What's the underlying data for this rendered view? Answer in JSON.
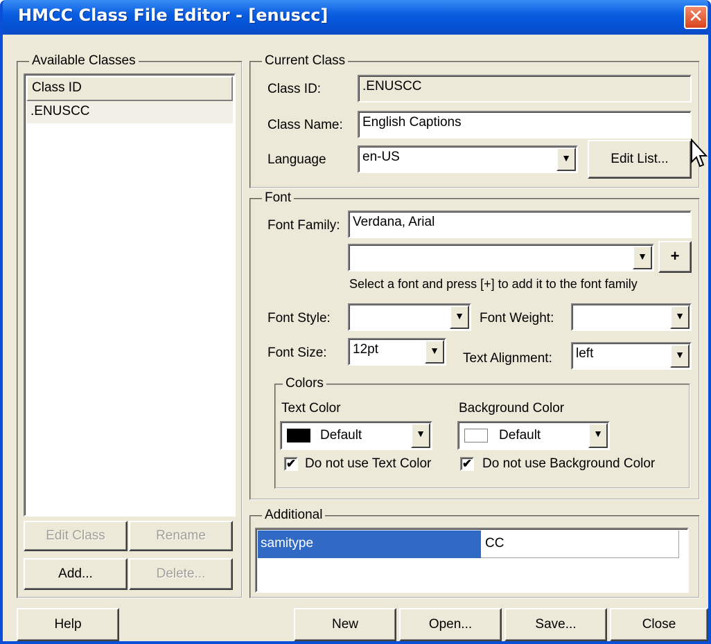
{
  "window": {
    "title": "HMCC Class File Editor - [enuscc]",
    "close_glyph": "✕"
  },
  "available_classes": {
    "legend": "Available Classes",
    "column_header": "Class ID",
    "rows": [
      ".ENUSCC"
    ],
    "buttons": {
      "edit_class": "Edit Class",
      "rename": "Rename",
      "add": "Add...",
      "delete": "Delete..."
    }
  },
  "current_class": {
    "legend": "Current Class",
    "class_id_label": "Class ID:",
    "class_id_value": ".ENUSCC",
    "class_name_label": "Class Name:",
    "class_name_value": "English Captions",
    "language_label": "Language",
    "language_value": "en-US",
    "edit_list_button": "Edit List..."
  },
  "font": {
    "legend": "Font",
    "family_label": "Font Family:",
    "family_value": "Verdana, Arial",
    "font_picker_value": "",
    "add_button": "+",
    "hint": "Select a font and press [+] to add it to the font family",
    "style_label": "Font Style:",
    "style_value": "",
    "weight_label": "Font Weight:",
    "weight_value": "",
    "size_label": "Font Size:",
    "size_value": "12pt",
    "alignment_label": "Text Alignment:",
    "alignment_value": "left"
  },
  "colors": {
    "legend": "Colors",
    "text_color_label": "Text Color",
    "text_color_value": "Default",
    "text_color_swatch": "#000000",
    "bg_color_label": "Background Color",
    "bg_color_value": "Default",
    "bg_color_swatch": "#ffffff",
    "no_text_color_label": "Do not use Text Color",
    "no_text_color_checked": true,
    "no_bg_color_label": "Do not use Background Color",
    "no_bg_color_checked": true
  },
  "additional": {
    "legend": "Additional",
    "rows": [
      {
        "key": "samitype",
        "value": "CC"
      }
    ]
  },
  "footer": {
    "help": "Help",
    "new": "New",
    "open": "Open...",
    "save": "Save...",
    "close": "Close"
  },
  "icons": {
    "dropdown": "chevron-down-icon",
    "checkbox_mark": "✔",
    "cursor": "mouse-pointer-icon"
  },
  "colors_theme": {
    "titlebar": "#0a5ee0",
    "selection": "#316ac5",
    "dialog_bg": "#ece9d8"
  }
}
